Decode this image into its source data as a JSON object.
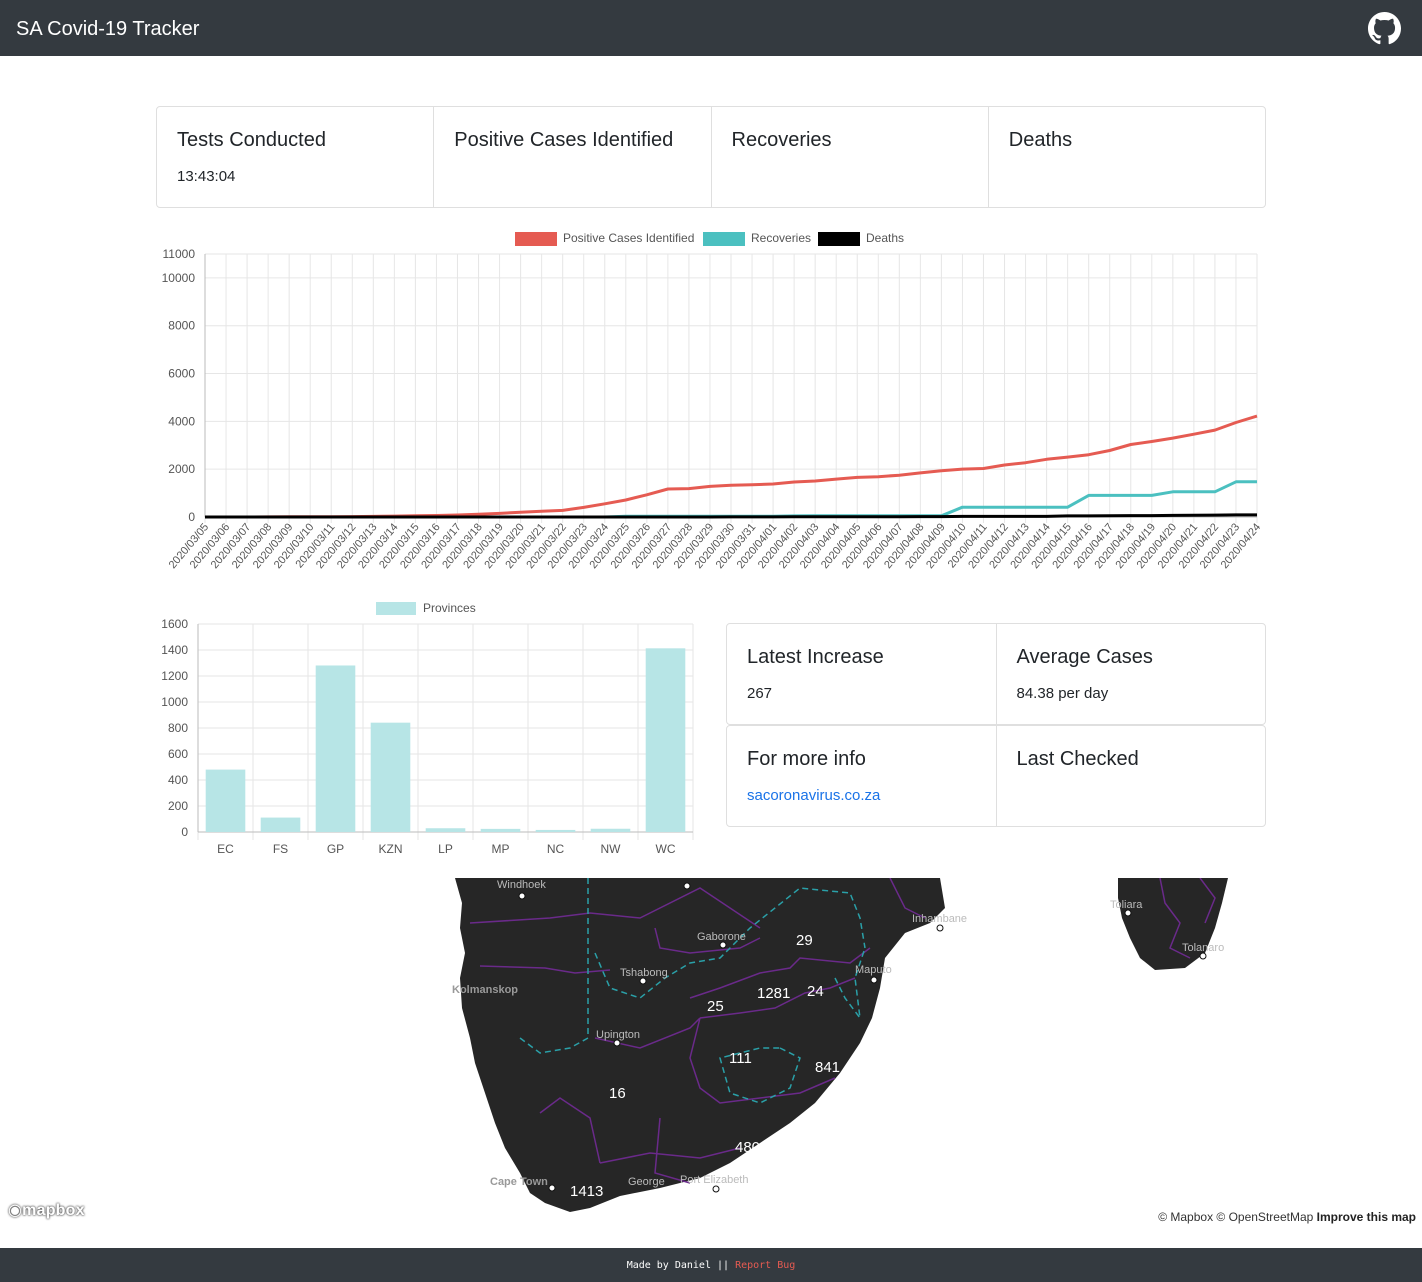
{
  "app": {
    "title": "SA Covid-19 Tracker",
    "github_icon": "github-icon"
  },
  "stats": {
    "tests_title": "Tests Conducted",
    "tests_value": "13:43:04",
    "positive_title": "Positive Cases Identified",
    "recoveries_title": "Recoveries",
    "deaths_title": "Deaths",
    "latest_increase_title": "Latest Increase",
    "latest_increase_value": "267",
    "average_title": "Average Cases",
    "average_value": "84.38 per day",
    "more_info_title": "For more info",
    "more_info_link": "sacoronavirus.co.za",
    "last_checked_title": "Last Checked"
  },
  "chart_data": [
    {
      "type": "line",
      "x": [
        "2020/03/05",
        "2020/03/06",
        "2020/03/07",
        "2020/03/08",
        "2020/03/09",
        "2020/03/10",
        "2020/03/11",
        "2020/03/12",
        "2020/03/13",
        "2020/03/14",
        "2020/03/15",
        "2020/03/16",
        "2020/03/17",
        "2020/03/18",
        "2020/03/19",
        "2020/03/20",
        "2020/03/21",
        "2020/03/22",
        "2020/03/23",
        "2020/03/24",
        "2020/03/25",
        "2020/03/26",
        "2020/03/27",
        "2020/03/28",
        "2020/03/29",
        "2020/03/30",
        "2020/03/31",
        "2020/04/01",
        "2020/04/02",
        "2020/04/03",
        "2020/04/04",
        "2020/04/05",
        "2020/04/06",
        "2020/04/07",
        "2020/04/08",
        "2020/04/09",
        "2020/04/10",
        "2020/04/11",
        "2020/04/12",
        "2020/04/13",
        "2020/04/14",
        "2020/04/15",
        "2020/04/16",
        "2020/04/17",
        "2020/04/18",
        "2020/04/19",
        "2020/04/20",
        "2020/04/21",
        "2020/04/22",
        "2020/04/23",
        "2020/04/24"
      ],
      "series": [
        {
          "name": "Positive Cases Identified",
          "color": "#e55b52",
          "values": [
            1,
            1,
            2,
            3,
            7,
            7,
            13,
            16,
            24,
            38,
            51,
            62,
            85,
            116,
            150,
            202,
            240,
            274,
            402,
            554,
            709,
            927,
            1170,
            1187,
            1280,
            1326,
            1353,
            1380,
            1462,
            1505,
            1585,
            1655,
            1686,
            1749,
            1845,
            1934,
            2003,
            2028,
            2173,
            2272,
            2415,
            2506,
            2605,
            2783,
            3034,
            3158,
            3300,
            3465,
            3635,
            3953,
            4220
          ]
        },
        {
          "name": "Recoveries",
          "color": "#4bc0c0",
          "values": [
            0,
            0,
            0,
            0,
            0,
            0,
            0,
            0,
            0,
            0,
            0,
            0,
            0,
            0,
            0,
            0,
            0,
            0,
            0,
            0,
            31,
            31,
            31,
            31,
            31,
            31,
            31,
            31,
            45,
            50,
            50,
            50,
            50,
            50,
            50,
            50,
            410,
            410,
            410,
            410,
            410,
            410,
            903,
            903,
            903,
            903,
            1055,
            1055,
            1055,
            1473,
            1473
          ]
        },
        {
          "name": "Deaths",
          "color": "#000000",
          "values": [
            0,
            0,
            0,
            0,
            0,
            0,
            0,
            0,
            0,
            0,
            0,
            0,
            0,
            0,
            0,
            0,
            0,
            0,
            0,
            0,
            0,
            0,
            1,
            1,
            2,
            3,
            5,
            5,
            9,
            11,
            11,
            12,
            12,
            13,
            18,
            18,
            24,
            25,
            25,
            27,
            27,
            48,
            48,
            52,
            58,
            58,
            65,
            75,
            79,
            86,
            87
          ]
        }
      ],
      "yticks": [
        0,
        2000,
        4000,
        6000,
        8000,
        10000,
        11000
      ],
      "ylim": [
        0,
        11000
      ],
      "grid": true,
      "legend": "top"
    },
    {
      "type": "bar",
      "categories": [
        "EC",
        "FS",
        "GP",
        "KZN",
        "LP",
        "MP",
        "NC",
        "NW",
        "WC"
      ],
      "series": [
        {
          "name": "Provinces",
          "color": "#b7e5e6",
          "values": [
            480,
            111,
            1281,
            841,
            29,
            24,
            16,
            25,
            1413
          ]
        }
      ],
      "yticks": [
        0,
        200,
        400,
        600,
        800,
        1000,
        1200,
        1400,
        1600
      ],
      "ylim": [
        0,
        1600
      ],
      "grid": true,
      "legend": "top"
    }
  ],
  "map": {
    "place_labels": [
      "Windhoek",
      "Gaborone",
      "Tshabong",
      "Kolmanskop",
      "Upington",
      "Maputo",
      "Inhambane",
      "Toliara",
      "Tolanaro",
      "Cape Town",
      "George",
      "Port Elizabeth"
    ],
    "case_counts": [
      "29",
      "1281",
      "24",
      "25",
      "111",
      "841",
      "16",
      "480",
      "1413"
    ],
    "logo": "mapbox",
    "attribution": "© Mapbox © OpenStreetMap",
    "improve": "Improve this map"
  },
  "footer": {
    "made_by": "Made by Daniel ||",
    "report_bug": "Report Bug"
  }
}
